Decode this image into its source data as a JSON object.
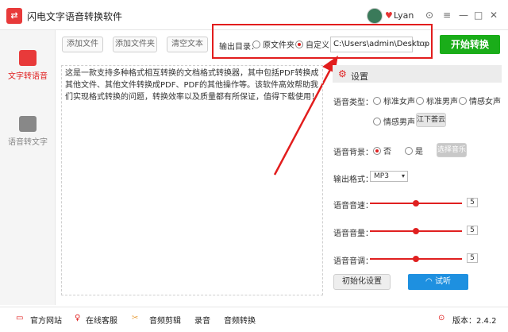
{
  "app": {
    "title": "闪电文字语音转换软件",
    "user": "Lyan",
    "version": "版本：2.4.2"
  },
  "sidebar": {
    "items": [
      {
        "label": "文字转语音"
      },
      {
        "label": "语音转文字"
      }
    ]
  },
  "toolbar": {
    "add_file": "添加文件",
    "add_folder": "添加文件夹",
    "clear_text": "清空文本"
  },
  "output": {
    "label": "输出目录：",
    "opt_source": "原文件夹",
    "opt_custom": "自定义",
    "path": "C:\\Users\\admin\\Desktop",
    "start": "开始转换"
  },
  "text": {
    "content": "这是一款支持多种格式相互转换的文档格式转换器，其中包括PDF转换成其他文件、其他文件转换成PDF、PDF的其他操作等。该软件高效帮助我们实现格式转换的问题，转换效率以及质量都有所保证，值得下载使用！"
  },
  "settings": {
    "title": "设置",
    "voice_type_label": "语音类型：",
    "voices": [
      "标准女声",
      "标准男声",
      "情感女声",
      "情感男声"
    ],
    "voice_extra": "江下荟云",
    "bg_label": "语音背景：",
    "bg_no": "否",
    "bg_yes": "是",
    "bg_choose": "选择音乐",
    "format_label": "输出格式：",
    "format_value": "MP3",
    "speed_label": "语音音速：",
    "speed_value": "5",
    "volume_label": "语音音量：",
    "volume_value": "5",
    "pitch_label": "语音音调：",
    "pitch_value": "5",
    "reset": "初始化设置",
    "listen": "试听"
  },
  "footer": {
    "website": "官方网站",
    "service": "在线客服",
    "audio_edit": "音频剪辑",
    "record": "录音",
    "audio_convert": "音频转换"
  }
}
